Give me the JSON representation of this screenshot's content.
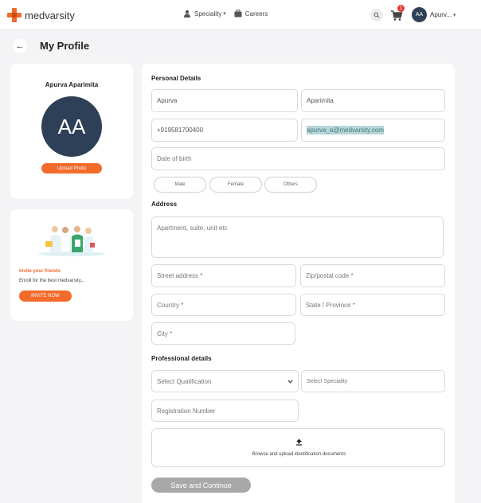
{
  "header": {
    "brand": "medvarsity",
    "nav": [
      {
        "label": "Speciality",
        "icon": "doctor-icon",
        "has_caret": true
      },
      {
        "label": "Careers",
        "icon": "briefcase-icon",
        "has_caret": false
      }
    ],
    "cart_count": "1",
    "user_initials": "AA",
    "user_name": "Apurv..."
  },
  "page": {
    "title": "My Profile"
  },
  "profile": {
    "name": "Apurva Aparimita",
    "initials": "AA",
    "upload_label": "Upload Photo"
  },
  "invite": {
    "title": "Invite your friends",
    "subtitle": "Enroll for the best medvarsity...",
    "button": "INVITE NOW"
  },
  "form": {
    "personal_title": "Personal Details",
    "first_name": "Apurva",
    "last_name": "Aparimita",
    "phone": "+919581700400",
    "email": "apurva_a@medvarsity.com",
    "dob_placeholder": "Date of birth",
    "genders": [
      "Male",
      "Female",
      "Others"
    ],
    "address_title": "Address",
    "apartment_placeholder": "Apartment, suite, unit etc",
    "street_placeholder": "Street address *",
    "zip_placeholder": "Zip/postal code *",
    "country_placeholder": "Country *",
    "state_placeholder": "State / Province *",
    "city_placeholder": "City *",
    "professional_title": "Professional details",
    "qualification_placeholder": "Select Qualification",
    "speciality_placeholder": "Select Speciality",
    "registration_placeholder": "Registration Number",
    "upload_docs_label": "Browse and upload identification documents",
    "save_label": "Save and Continue"
  },
  "colors": {
    "accent": "#f26b2a",
    "avatar": "#2e4057",
    "disabled_button": "#a8a8a8",
    "email_highlight": "#b5d7d8"
  }
}
